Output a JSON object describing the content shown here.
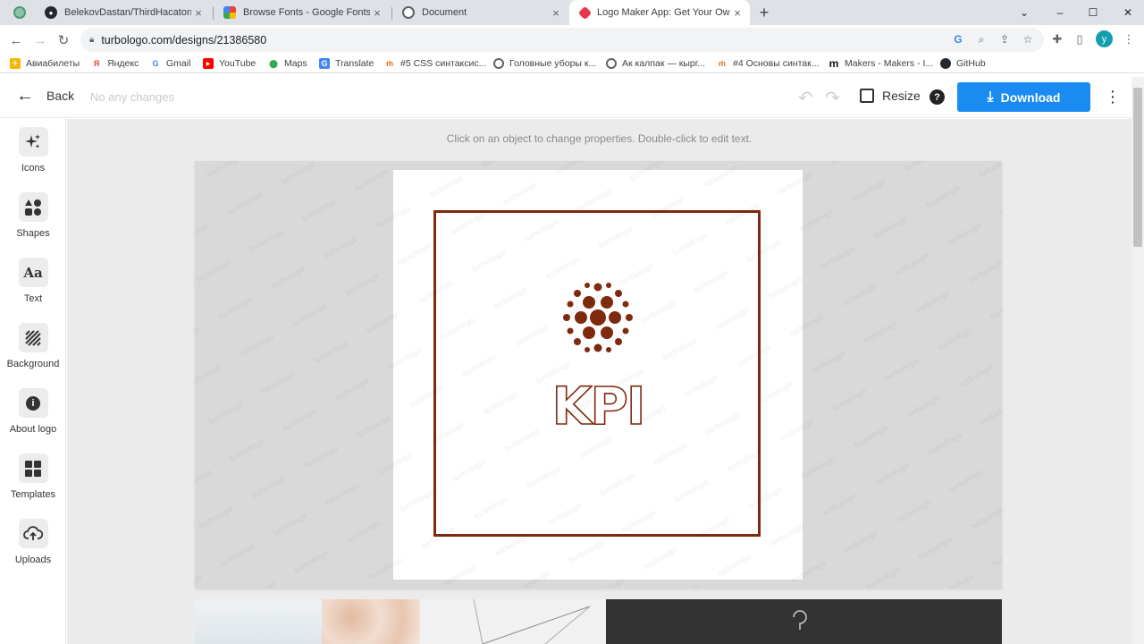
{
  "browser": {
    "tabs": [
      {
        "title": "BelekovDastan/ThirdHacaton_In",
        "active": false
      },
      {
        "title": "Browse Fonts - Google Fonts",
        "active": false
      },
      {
        "title": "Document",
        "active": false
      },
      {
        "title": "Logo Maker App: Get Your Own",
        "active": true
      }
    ],
    "new_tab": "+",
    "window_controls": {
      "minimize": "–",
      "maximize": "☐",
      "close": "✕",
      "tab_list": "⌄"
    },
    "url": "turbologo.com/designs/21386580",
    "profile_initial": "y",
    "bookmarks": [
      "Авиабилеты",
      "Яндекс",
      "Gmail",
      "YouTube",
      "Maps",
      "Translate",
      "#5 CSS синтаксис...",
      "Головные уборы к...",
      "Ак калпак — кырг...",
      "#4 Основы синтак...",
      "Makers - Makers - I...",
      "GitHub"
    ]
  },
  "header": {
    "back_label": "Back",
    "status": "No any changes",
    "resize_label": "Resize",
    "help_glyph": "?",
    "download_label": "Download"
  },
  "sidebar": {
    "items": [
      {
        "label": "Icons",
        "icon": "sparkles-icon"
      },
      {
        "label": "Shapes",
        "icon": "shapes-icon"
      },
      {
        "label": "Text",
        "icon": "text-icon",
        "glyph": "Aa"
      },
      {
        "label": "Background",
        "icon": "background-icon"
      },
      {
        "label": "About logo",
        "icon": "info-icon",
        "glyph": "i"
      },
      {
        "label": "Templates",
        "icon": "templates-icon"
      },
      {
        "label": "Uploads",
        "icon": "cloud-upload-icon"
      }
    ]
  },
  "canvas": {
    "hint": "Click on an object to change properties. Double-click to edit text.",
    "watermark": "turbologo",
    "logo_text": "KPI",
    "logo_color": "#7e2a0f",
    "frame_color": "#7e2a0f"
  },
  "colors": {
    "accent": "#1a8bf0",
    "tab_strip": "#dee1e6",
    "workspace": "#ebebeb",
    "stage": "#d9d9d9"
  }
}
